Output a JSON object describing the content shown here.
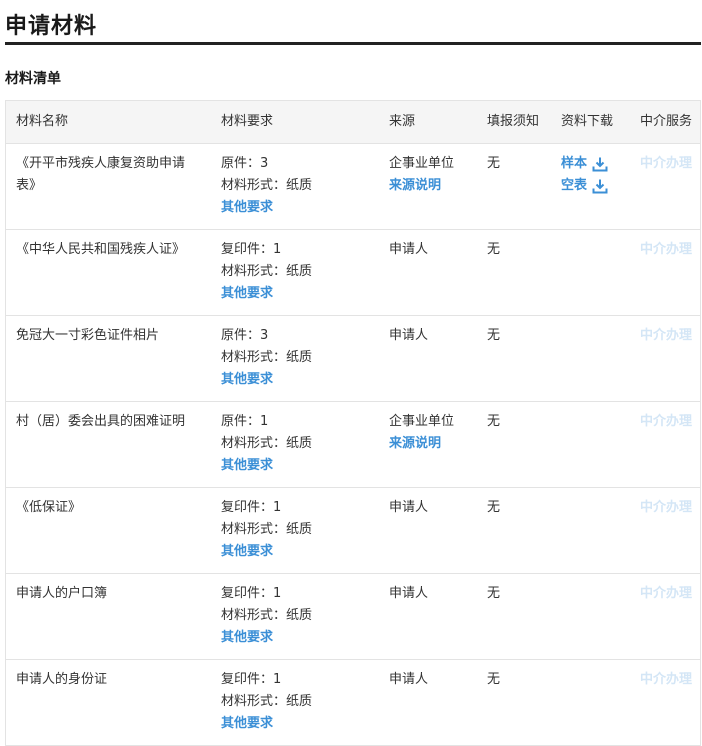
{
  "page": {
    "title": "申请材料",
    "section_title": "材料清单"
  },
  "table": {
    "headers": {
      "name": "材料名称",
      "requirement": "材料要求",
      "source": "来源",
      "fill_notice": "填报须知",
      "download": "资料下载",
      "service": "中介服务"
    },
    "rows": [
      {
        "name": "《开平市残疾人康复资助申请表》",
        "copy": "原件：3",
        "form": "材料形式：纸质",
        "other": "其他要求",
        "source": "企事业单位",
        "source_note": "来源说明",
        "fill": "无",
        "sample": "样本",
        "blank": "空表",
        "service": "中介办理"
      },
      {
        "name": "《中华人民共和国残疾人证》",
        "copy": "复印件：1",
        "form": "材料形式：纸质",
        "other": "其他要求",
        "source": "申请人",
        "fill": "无",
        "service": "中介办理"
      },
      {
        "name": "免冠大一寸彩色证件相片",
        "copy": "原件：3",
        "form": "材料形式：纸质",
        "other": "其他要求",
        "source": "申请人",
        "fill": "无",
        "service": "中介办理"
      },
      {
        "name": "村（居）委会出具的困难证明",
        "copy": "原件：1",
        "form": "材料形式：纸质",
        "other": "其他要求",
        "source": "企事业单位",
        "source_note": "来源说明",
        "fill": "无",
        "service": "中介办理"
      },
      {
        "name": "《低保证》",
        "copy": "复印件：1",
        "form": "材料形式：纸质",
        "other": "其他要求",
        "source": "申请人",
        "fill": "无",
        "service": "中介办理"
      },
      {
        "name": "申请人的户口簿",
        "copy": "复印件：1",
        "form": "材料形式：纸质",
        "other": "其他要求",
        "source": "申请人",
        "fill": "无",
        "service": "中介办理"
      },
      {
        "name": "申请人的身份证",
        "copy": "复印件：1",
        "form": "材料形式：纸质",
        "other": "其他要求",
        "source": "申请人",
        "fill": "无",
        "service": "中介办理"
      }
    ]
  },
  "icons": {
    "download": "download-icon"
  },
  "colors": {
    "link": "#3b8fd6",
    "disabled_link": "#d4e6f6",
    "header_bg": "#f5f5f5",
    "title_rule": "#222222"
  }
}
